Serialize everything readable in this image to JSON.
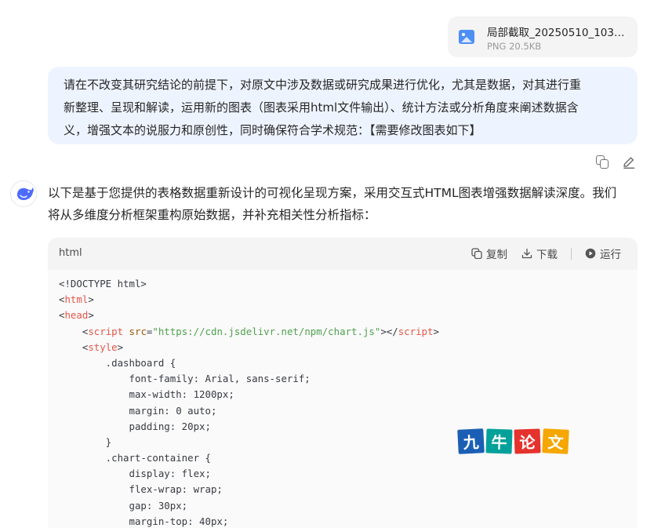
{
  "attachment": {
    "filename": "局部截取_20250510_1036...",
    "meta": "PNG 20.5KB"
  },
  "user_message": {
    "lines": [
      "请在不改变其研究结论的前提下，对原文中涉及数据或研究成果进行优化，尤其是数据，对其进行重",
      "新整理、呈现和解读，运用新的图表（图表采用html文件输出）、统计方法或分析角度来阐述数据含",
      "义，增强文本的说服力和原创性，同时确保符合学术规范：【需要修改图表如下】"
    ]
  },
  "assistant_message": {
    "lines": [
      "以下是基于您提供的表格数据重新设计的可视化呈现方案，采用交互式HTML图表增强数据解读深度。我们",
      "将从多维度分析框架重构原始数据，并补充相关性分析指标："
    ]
  },
  "code_block": {
    "language": "html",
    "copy_label": "复制",
    "download_label": "下载",
    "run_label": "运行",
    "lines": {
      "l1": "<!DOCTYPE html>",
      "l2_open": "<",
      "l2_tag": "html",
      "l2_close": ">",
      "l3_open": "<",
      "l3_tag": "head",
      "l3_close": ">",
      "l4_indent": "    ",
      "l4_open": "<",
      "l4_tag": "script",
      "l4_attr": " src",
      "l4_eq": "=",
      "l4_str": "\"https://cdn.jsdelivr.net/npm/chart.js\"",
      "l4_mid": "></",
      "l4_tag2": "script",
      "l4_end": ">",
      "l5_indent": "    ",
      "l5_open": "<",
      "l5_tag": "style",
      "l5_close": ">",
      "l6": "        .dashboard {",
      "l7": "            font-family: Arial, sans-serif;",
      "l8": "            max-width: 1200px;",
      "l9": "            margin: 0 auto;",
      "l10": "            padding: 20px;",
      "l11": "        }",
      "l12": "        .chart-container {",
      "l13": "            display: flex;",
      "l14": "            flex-wrap: wrap;",
      "l15": "            gap: 30px;",
      "l16": "            margin-top: 40px;"
    }
  },
  "watermark": {
    "chars": [
      "九",
      "牛",
      "论",
      "文"
    ],
    "colors": [
      "#1a5fb4",
      "#00a19a",
      "#e5322d",
      "#f5a700"
    ]
  }
}
